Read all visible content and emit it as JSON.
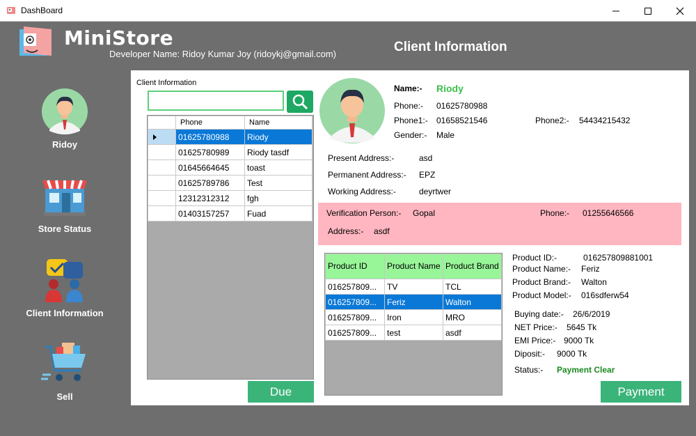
{
  "window": {
    "title": "DashBoard",
    "controls": [
      "minimize-icon",
      "maximize-icon",
      "close-icon"
    ]
  },
  "header": {
    "brand": "MiniStore",
    "developer": "Developer Name: Ridoy Kumar Joy (ridoykj@gmail.com)",
    "page_title": "Client Information"
  },
  "sidebar": {
    "items": [
      {
        "label": "Ridoy",
        "icon": "user-avatar-icon"
      },
      {
        "label": "Store Status",
        "icon": "store-icon"
      },
      {
        "label": "Client Information",
        "icon": "client-chat-icon"
      },
      {
        "label": "Sell",
        "icon": "shopping-cart-icon"
      }
    ]
  },
  "client_list": {
    "label": "Client Information",
    "search_value": "",
    "columns": [
      "Phone",
      "Name"
    ],
    "rows": [
      {
        "phone": "01625780988",
        "name": "Riody",
        "selected": true
      },
      {
        "phone": "01625780989",
        "name": "Riody tasdf",
        "selected": false
      },
      {
        "phone": "01645664645",
        "name": "toast",
        "selected": false
      },
      {
        "phone": "01625789786",
        "name": "Test",
        "selected": false
      },
      {
        "phone": "12312312312",
        "name": "fgh",
        "selected": false
      },
      {
        "phone": "01403157257",
        "name": "Fuad",
        "selected": false
      }
    ],
    "due_button": "Due"
  },
  "client_detail": {
    "name_label": "Name:-",
    "name": "Riody",
    "phone_label": "Phone:-",
    "phone": "01625780988",
    "phone1_label": "Phone1:-",
    "phone1": "01658521546",
    "phone2_label": "Phone2:-",
    "phone2": "54434215432",
    "gender_label": "Gender:-",
    "gender": "Male",
    "present_label": "Present Address:-",
    "present": "asd",
    "permanent_label": "Permanent Address:-",
    "permanent": "EPZ",
    "working_label": "Working Address:-",
    "working": "deyrtwer"
  },
  "verification": {
    "person_label": "Verification Person:-",
    "person": "Gopal",
    "phone_label": "Phone:-",
    "phone": "01255646566",
    "address_label": "Address:-",
    "address": "asdf"
  },
  "products": {
    "columns": [
      "Product ID",
      "Product Name",
      "Product Brand"
    ],
    "rows": [
      {
        "id": "016257809...",
        "name": "TV",
        "brand": "TCL",
        "selected": false
      },
      {
        "id": "016257809...",
        "name": "Feriz",
        "brand": "Walton",
        "selected": true
      },
      {
        "id": "016257809...",
        "name": "Iron",
        "brand": "MRO",
        "selected": false
      },
      {
        "id": "016257809...",
        "name": "test",
        "brand": "asdf",
        "selected": false
      }
    ]
  },
  "product_detail": {
    "id_label": "Product ID:-",
    "id": "016257809881001",
    "name_label": "Product Name:-",
    "name": "Feriz",
    "brand_label": "Product Brand:-",
    "brand": "Walton",
    "model_label": "Product Model:-",
    "model": "016sdferw54",
    "buying_label": "Buying date:-",
    "buying": "26/6/2019",
    "net_label": "NET Price:-",
    "net": "5645 Tk",
    "emi_label": "EMI Price:-",
    "emi": "9000 Tk",
    "deposit_label": "Diposit:-",
    "deposit": "9000 Tk",
    "status_label": "Status:-",
    "status": "Payment Clear",
    "payment_button": "Payment"
  },
  "colors": {
    "accent_green": "#3bb47a",
    "selection_blue": "#0a78d7",
    "verification_bg": "#ffb6c1",
    "product_header_bg": "#98f598",
    "background": "#6e6e6e"
  }
}
